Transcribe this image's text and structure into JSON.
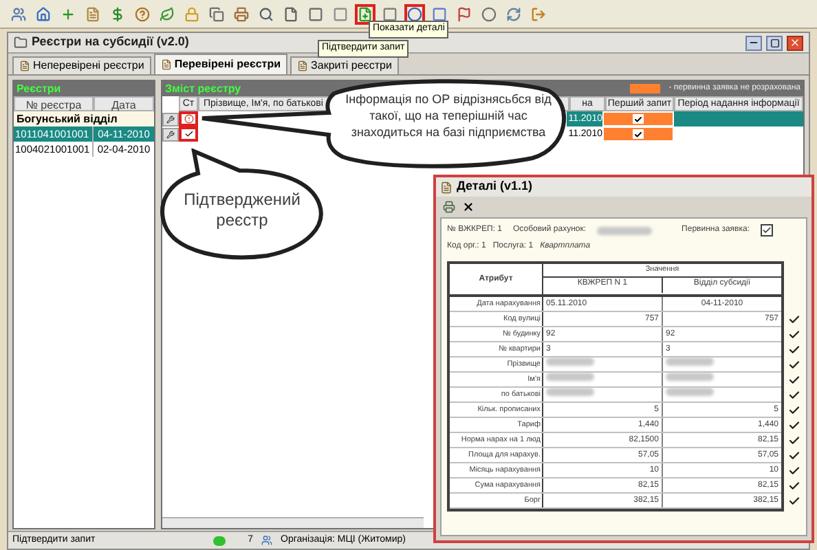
{
  "toolbar": [
    {
      "highlighted": false
    },
    {
      "highlighted": false
    },
    {
      "highlighted": false
    },
    {
      "highlighted": false
    },
    {
      "highlighted": false
    },
    {
      "highlighted": false
    },
    {
      "highlighted": false
    },
    {
      "highlighted": false
    },
    {
      "highlighted": false
    },
    {
      "highlighted": false
    },
    {
      "highlighted": false
    },
    {
      "highlighted": false
    },
    {
      "highlighted": false
    },
    {
      "highlighted": false
    },
    {
      "highlighted": true
    },
    {
      "highlighted": false
    },
    {
      "highlighted": true
    },
    {
      "highlighted": false
    },
    {
      "highlighted": false
    },
    {
      "highlighted": false
    },
    {
      "highlighted": false
    },
    {
      "highlighted": false
    }
  ],
  "tooltips": [
    "Підтвердити запит",
    "Показати деталі"
  ],
  "window": {
    "title": "Реєстри на субсидії (v2.0)"
  },
  "tabs": [
    {
      "label": "Неперевірені реєстри",
      "selected": false
    },
    {
      "label": "Перевірені реєстри",
      "selected": true
    },
    {
      "label": "Закриті реєстри",
      "selected": false
    }
  ],
  "registers": {
    "title": "Реєстри",
    "columns": [
      "№ реєстра",
      "Дата"
    ],
    "group": "Богунський відділ",
    "rows": [
      {
        "number": "1011041001001",
        "date": "04-11-2010",
        "selected": true
      },
      {
        "number": "1004021001001",
        "date": "02-04-2010",
        "selected": false
      }
    ]
  },
  "contents": {
    "title": "Зміст реєстру",
    "legend": [
      {
        "color": "#ff8030",
        "text": "- первинна заявка не розрахована"
      }
    ],
    "columns": [
      "Ст",
      "Прізвище, Ім'я, по батькові",
      "на",
      "Перший запит",
      "Період надання інформації"
    ],
    "rows": [
      {
        "kind": "changed",
        "highlighted": true,
        "selected": true,
        "date": "11.2010",
        "first_request": true
      },
      {
        "kind": "confirmed",
        "highlighted": true,
        "selected": false,
        "date": "11.2010",
        "first_request": true
      }
    ]
  },
  "callouts": [
    "Інформація по ОР відрізнясьбся від такої, що на теперішній час знаходиться на базі підприємства",
    "Підтверджений реєстр"
  ],
  "status_bar": {
    "message": "Підтвердити запит",
    "count": "7",
    "organization": "Організація: МЦІ (Житомир)"
  },
  "details": {
    "title": "Деталі (v1.1)",
    "vzhkrep": "№ ВЖКРЕП: 1",
    "account_label": "Особовий рахунок:",
    "primary_label": "Первинна заявка:",
    "primary_checked": true,
    "org": "Код орг.: 1",
    "service_label": "Послуга: 1",
    "service": "Квартплата",
    "columns": {
      "attribute": "Атрибут",
      "values": "Значення",
      "source_1": "КВЖРЕП N 1",
      "source_2": "Відділ субсидії"
    },
    "rows": [
      {
        "attribute": "Дата нарахування",
        "value_1": "05.11.2010",
        "value_2": "04-11-2010",
        "kind": "date",
        "matched": false
      },
      {
        "attribute": "Код вулиці",
        "value_1": "757",
        "value_2": "757",
        "kind": "number",
        "matched": true
      },
      {
        "attribute": "№ будинку",
        "value_1": "92",
        "value_2": "92",
        "kind": "text",
        "matched": true
      },
      {
        "attribute": "№ квартири",
        "value_1": "3",
        "value_2": "3",
        "kind": "text",
        "matched": true
      },
      {
        "attribute": "Прізвище",
        "kind": "hidden",
        "matched": true
      },
      {
        "attribute": "Ім'я",
        "kind": "hidden",
        "matched": true
      },
      {
        "attribute": "по батькові",
        "kind": "hidden",
        "matched": true
      },
      {
        "attribute": "Кільк. прописаних",
        "value_1": "5",
        "value_2": "5",
        "kind": "number",
        "matched": true
      },
      {
        "attribute": "Тариф",
        "value_1": "1,440",
        "value_2": "1,440",
        "kind": "number",
        "matched": true
      },
      {
        "attribute": "Норма нарах на 1 люд",
        "value_1": "82,1500",
        "value_2": "82,15",
        "kind": "number",
        "matched": true
      },
      {
        "attribute": "Площа для нарахув.",
        "value_1": "57,05",
        "value_2": "57,05",
        "kind": "number",
        "matched": true
      },
      {
        "attribute": "Місяць нарахування",
        "value_1": "10",
        "value_2": "10",
        "kind": "number",
        "matched": true
      },
      {
        "attribute": "Сума нарахування",
        "value_1": "82,15",
        "value_2": "82,15",
        "kind": "number",
        "matched": true
      },
      {
        "attribute": "Борг",
        "value_1": "382,15",
        "value_2": "382,15",
        "kind": "number",
        "matched": true
      }
    ]
  }
}
